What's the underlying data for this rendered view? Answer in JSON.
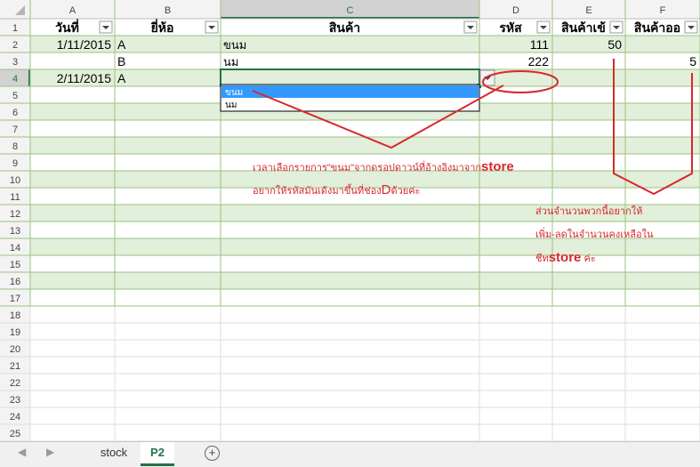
{
  "colors": {
    "header_bg": "#f3f3f3",
    "band": "#e2efda",
    "grid": "#9bc283",
    "accent": "#217346",
    "annot": "#d9262c",
    "dropdown_sel": "#3399ff"
  },
  "columns": [
    "A",
    "B",
    "C",
    "D",
    "E",
    "F"
  ],
  "row_numbers": [
    "1",
    "2",
    "3",
    "4",
    "5",
    "6",
    "7",
    "8",
    "9",
    "10",
    "11",
    "12",
    "13",
    "14",
    "15",
    "16",
    "17",
    "18",
    "19",
    "20",
    "21",
    "22",
    "23",
    "24",
    "25"
  ],
  "table": {
    "headers": [
      "วันที่",
      "ยี่ห้อ",
      "สินค้า",
      "รหัส",
      "สินค้าเข้",
      "สินค้าออ"
    ],
    "rows": [
      [
        "1/11/2015",
        "A",
        "ขนม",
        "111",
        "50",
        ""
      ],
      [
        "",
        "B",
        "นม",
        "222",
        "",
        "5"
      ],
      [
        "2/11/2015",
        "A",
        "",
        "",
        "",
        ""
      ]
    ]
  },
  "dropdown": {
    "options": [
      "ขนม",
      "นม"
    ],
    "selected_index": 0
  },
  "annotations": {
    "note1_line1": "เวลาเลือกรายการ\"ขนม\"จากดรอปดาวน์ที่อ้างอิงมาจาก",
    "note1_line1_big": "store",
    "note1_line2": "อยากให้รหัสมันเด้งมาขึ้นที่ช่อง",
    "note1_line2_big": "D",
    "note1_line2_end": "ด้วยค่ะ",
    "note2_line1": "ส่วนจำนวนพวกนี้อยากให้",
    "note2_line2": "เพิ่ม-ลดในจำนวนคงเหลือใน",
    "note2_line3_a": "ชีท",
    "note2_line3_big": "store",
    "note2_line3_b": " ค่ะ"
  },
  "sheet_tabs": {
    "tabs": [
      "stock",
      "P2"
    ],
    "active": "P2",
    "add_symbol": "+"
  }
}
